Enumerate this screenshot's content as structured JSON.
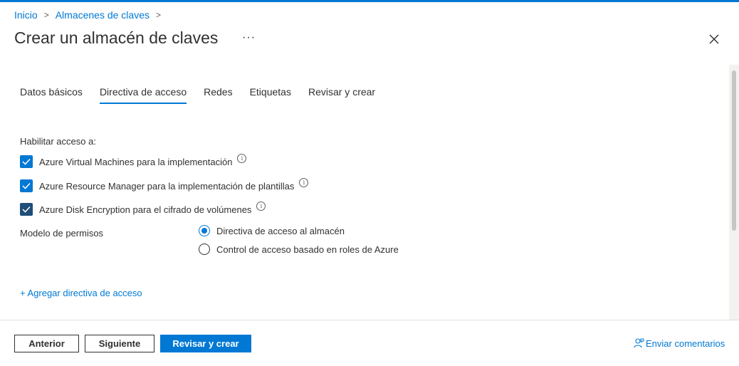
{
  "breadcrumb": {
    "home": "Inicio",
    "parent": "Almacenes de claves",
    "sep": ">"
  },
  "header": {
    "title": "Crear un almacén de claves",
    "more": "···"
  },
  "tabs": [
    {
      "label": "Datos básicos",
      "active": false
    },
    {
      "label": "Directiva de acceso",
      "active": true
    },
    {
      "label": "Redes",
      "active": false
    },
    {
      "label": "Etiquetas",
      "active": false
    },
    {
      "label": "Revisar y crear",
      "active": false
    }
  ],
  "access": {
    "label": "Habilitar acceso a:",
    "options": [
      {
        "label": "Azure Virtual Machines para la implementación",
        "checked": true
      },
      {
        "label": "Azure Resource Manager para la implementación de plantillas",
        "checked": true
      },
      {
        "label": "Azure Disk Encryption para el cifrado de volúmenes",
        "checked": true
      }
    ],
    "info_glyph": "i"
  },
  "permissions": {
    "label": "Modelo de permisos",
    "options": [
      {
        "label": "Directiva de acceso al almacén",
        "selected": true
      },
      {
        "label": "Control de acceso basado en roles de Azure",
        "selected": false
      }
    ]
  },
  "add_policy_link": "+ Agregar directiva de acceso",
  "footer": {
    "previous": "Anterior",
    "next": "Siguiente",
    "review_create": "Revisar y crear",
    "feedback": "Enviar comentarios"
  },
  "colors": {
    "accent": "#0078d4",
    "text": "#323130",
    "checkbox_focused": "#1f4e79"
  }
}
